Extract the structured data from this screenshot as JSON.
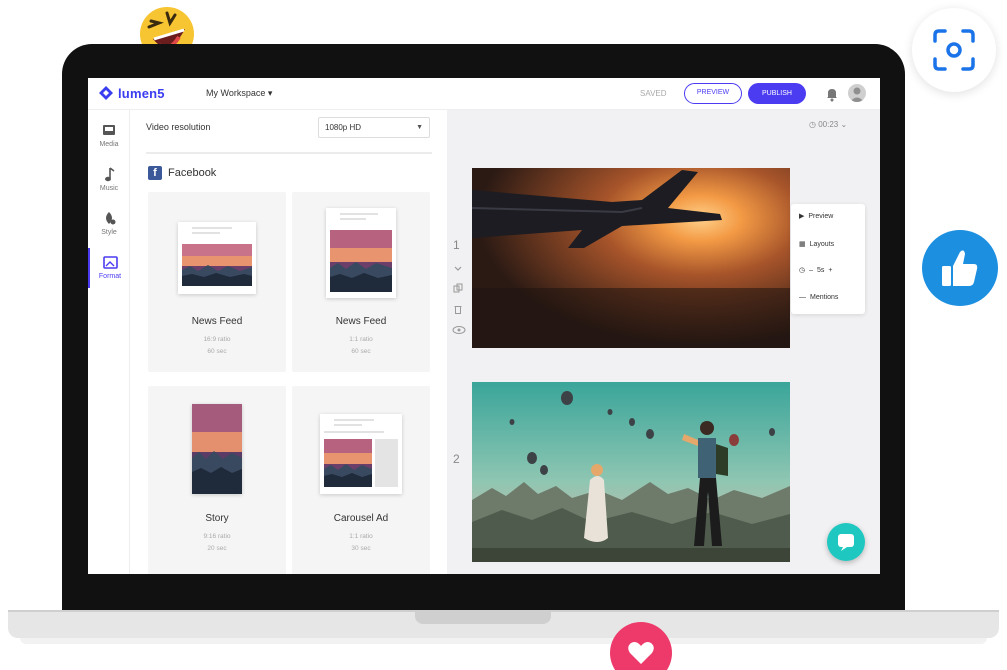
{
  "app": {
    "logo_text": "lumen5",
    "workspace": "My Workspace",
    "status": "SAVED",
    "preview_label": "PREVIEW",
    "publish_label": "PUBLISH"
  },
  "rail": {
    "items": [
      {
        "label": "Media",
        "icon": "media-icon"
      },
      {
        "label": "Music",
        "icon": "music-icon"
      },
      {
        "label": "Style",
        "icon": "style-icon"
      },
      {
        "label": "Format",
        "icon": "format-icon",
        "active": true
      }
    ]
  },
  "format_panel": {
    "resolution_label": "Video resolution",
    "resolution_value": "1080p HD",
    "platform": "Facebook",
    "cards": [
      {
        "title": "News Feed",
        "ratio": "16:9 ratio",
        "duration": "60 sec"
      },
      {
        "title": "News Feed",
        "ratio": "1:1 ratio",
        "duration": "60 sec"
      },
      {
        "title": "Story",
        "ratio": "9:16 ratio",
        "duration": "20 sec"
      },
      {
        "title": "Carousel Ad",
        "ratio": "1:1 ratio",
        "duration": "30 sec"
      }
    ]
  },
  "canvas": {
    "timer": "00:23",
    "scenes": [
      {
        "number": "1",
        "description": "airplane wing at sunset"
      },
      {
        "number": "2",
        "description": "hot air balloons and traveler"
      }
    ],
    "scene_menu": [
      {
        "label": "Preview",
        "icon": "play-icon"
      },
      {
        "label": "Layouts",
        "icon": "layout-icon"
      },
      {
        "label": "5s",
        "icon": "clock-icon"
      },
      {
        "label": "Mentions",
        "icon": "mention-icon"
      }
    ]
  },
  "colors": {
    "brand": "#4b3cf2",
    "facebook": "#3b5998",
    "add_button": "#2fc36a",
    "chat_button": "#1ec8c0",
    "like_bubble": "#1c8fe0",
    "heart_bubble": "#ee3a6a"
  }
}
